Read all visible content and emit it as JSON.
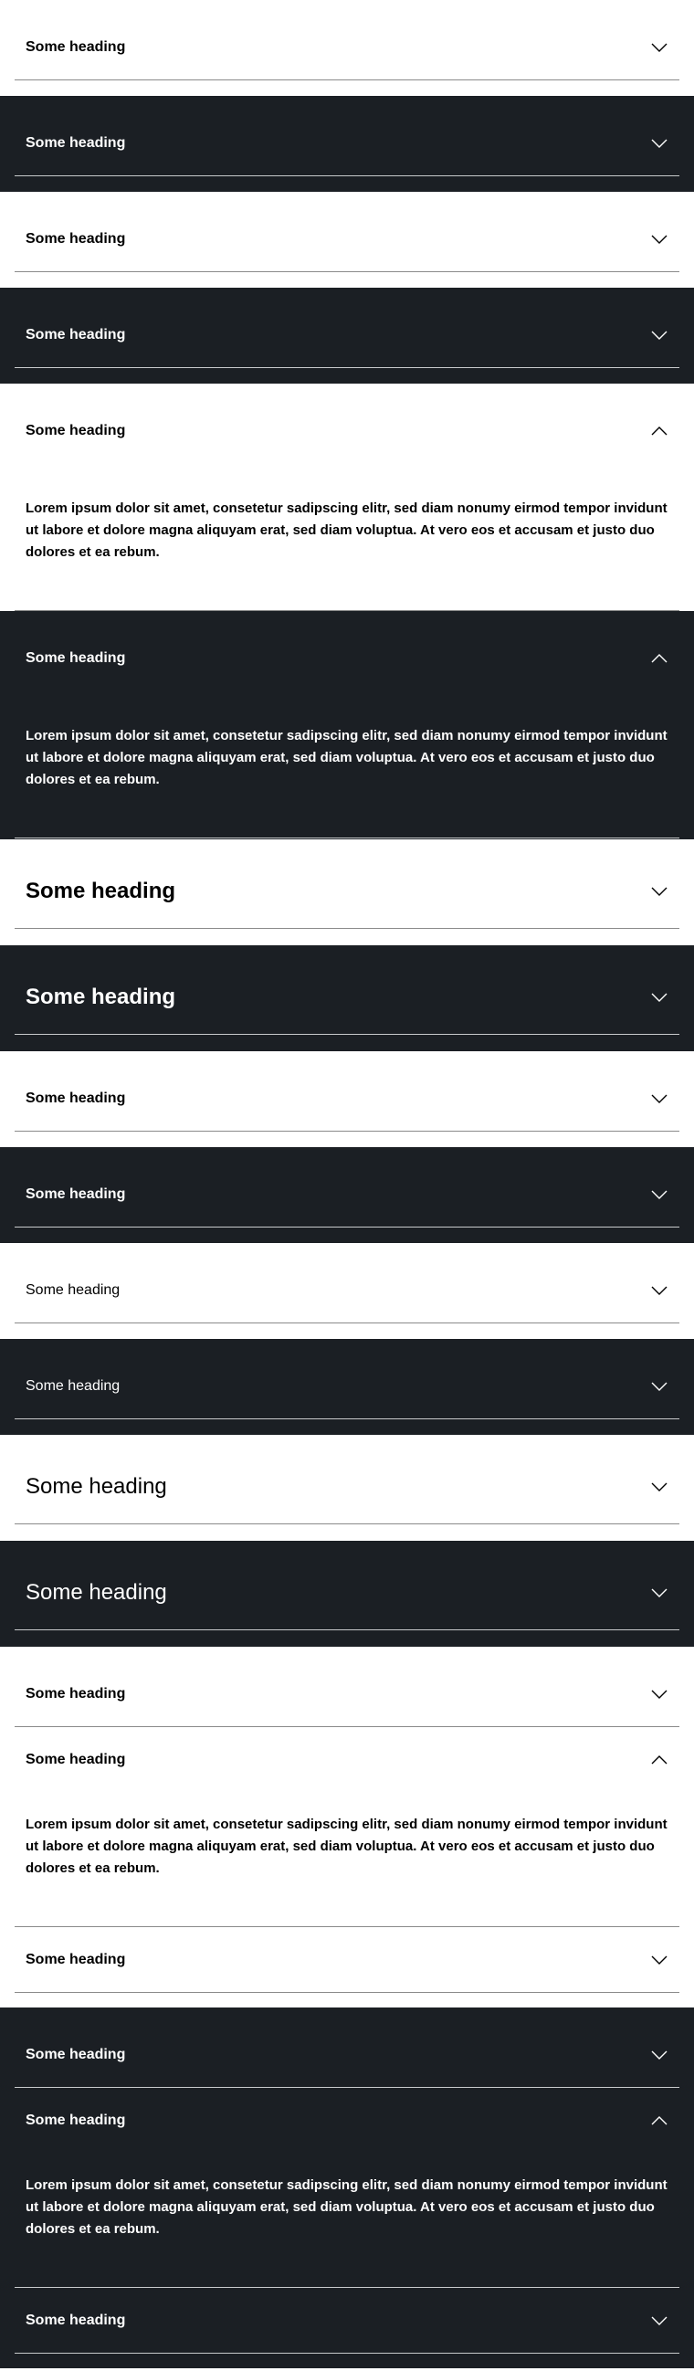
{
  "heading": "Some heading",
  "body_text": "Lorem ipsum dolor sit amet, consetetur sadipscing elitr, sed diam nonumy eirmod tempor invidunt ut labore et dolore magna aliquyam erat, sed diam voluptua. At vero eos et accusam et justo duo dolores et ea rebum.",
  "colors": {
    "light_bg": "#ffffff",
    "dark_bg": "#1b1f24",
    "divider_light": "#8a8a8a",
    "divider_dark": "#c8cacc"
  },
  "icons": {
    "collapsed": "chevron-down-icon",
    "expanded": "chevron-up-icon"
  }
}
